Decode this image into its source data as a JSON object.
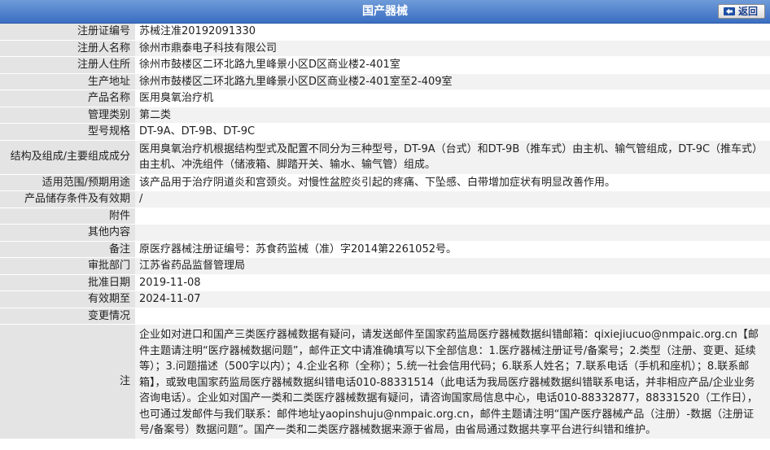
{
  "header": {
    "title": "国产器械",
    "back_label": "返回"
  },
  "rows": [
    {
      "label": "注册证编号",
      "value": "苏械注准20192091330"
    },
    {
      "label": "注册人名称",
      "value": "徐州市鼎泰电子科技有限公司"
    },
    {
      "label": "注册人住所",
      "value": "徐州市鼓楼区二环北路九里峰景小区D区商业楼2-401室"
    },
    {
      "label": "生产地址",
      "value": "徐州市鼓楼区二环北路九里峰景小区D区商业楼2-401室至2-409室"
    },
    {
      "label": "产品名称",
      "value": "医用臭氧治疗机"
    },
    {
      "label": "管理类别",
      "value": "第二类"
    },
    {
      "label": "型号规格",
      "value": "DT-9A、DT-9B、DT-9C"
    },
    {
      "label": "结构及组成/主要组成成分",
      "value": "医用臭氧治疗机根据结构型式及配置不同分为三种型号，DT-9A（台式）和DT-9B（推车式）由主机、输气管组成，DT-9C（推车式）由主机、冲洗组件（储液箱、脚踏开关、输水、输气管）组成。"
    },
    {
      "label": "适用范围/预期用途",
      "value": "该产品用于治疗阴道炎和宫颈炎。对慢性盆腔炎引起的疼痛、下坠感、白带增加症状有明显改善作用。"
    },
    {
      "label": "产品储存条件及有效期",
      "value": "/"
    },
    {
      "label": "附件",
      "value": ""
    },
    {
      "label": "其他内容",
      "value": ""
    },
    {
      "label": "备注",
      "value": "原医疗器械注册证编号：苏食药监械（准）字2014第2261052号。"
    },
    {
      "label": "审批部门",
      "value": "江苏省药品监督管理局"
    },
    {
      "label": "批准日期",
      "value": "2019-11-08"
    },
    {
      "label": "有效期至",
      "value": "2024-11-07"
    },
    {
      "label": "变更情况",
      "value": ""
    }
  ],
  "note": {
    "label": "注",
    "value": "企业如对进口和国产三类医疗器械数据有疑问，请发送邮件至国家药监局医疗器械数据纠错邮箱：qixiejiucuo@nmpaic.org.cn【邮件主题请注明“医疗器械数据问题”，邮件正文中请准确填写以下全部信息：1.医疗器械注册证号/备案号；2.类型（注册、变更、延续等）；3.问题描述（500字以内）；4.企业名称（全称）；5.统一社会信用代码；6.联系人姓名；7.联系电话（手机和座机）；8.联系邮箱】，或致电国家药监局医疗器械数据纠错电话010-88331514（此电话为我局医疗器械数据纠错联系电话，并非相应产品/企业业务咨询电话）。企业如对国产一类和二类医疗器械数据有疑问，请咨询国家局信息中心，电话010-88332877，88331520（工作日），也可通过发邮件与我们联系：邮件地址yaopinshuju@nmpaic.org.cn，邮件主题请注明“国产医疗器械产品（注册）-数据（注册证号/备案号）数据问题”。国产一类和二类医疗器械数据来源于省局，由省局通过数据共享平台进行纠错和维护。"
  },
  "colors": {
    "header_top": "#6f9bd9",
    "header_bottom": "#3a6ec2",
    "label_bg": "#e4e4e4",
    "alt_row_bg": "#f2f2f2"
  }
}
